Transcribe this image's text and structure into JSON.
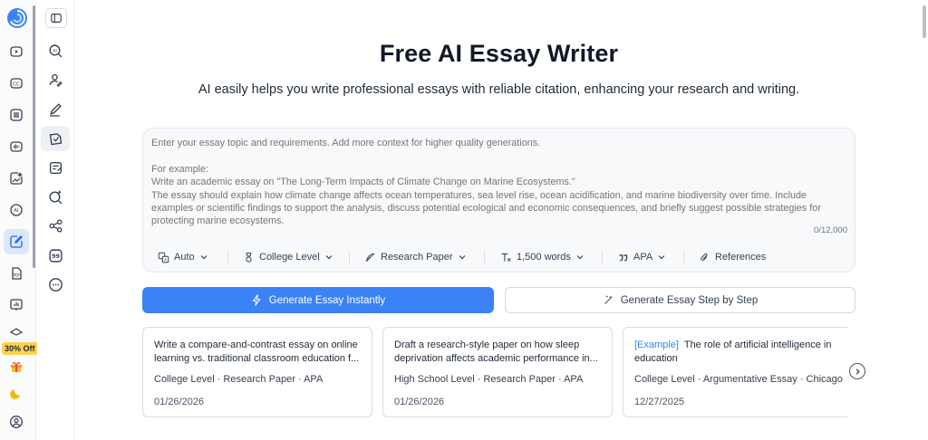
{
  "promo": {
    "badge": "30% Off"
  },
  "main": {
    "title": "Free AI Essay Writer",
    "subtitle": "AI easily helps you write professional essays with reliable citation, enhancing your research and writing."
  },
  "composer": {
    "placeholder": "Enter your essay topic and requirements. Add more context for higher quality generations.\n\nFor example:\nWrite an academic essay on \"The Long-Term Impacts of Climate Change on Marine Ecosystems.\"\nThe essay should explain how climate change affects ocean temperatures, sea level rise, ocean acidification, and marine biodiversity over time. Include examples or scientific findings to support the analysis, discuss potential ecological and economic consequences, and briefly suggest possible strategies for protecting marine ecosystems.",
    "value": "",
    "counter": "0/12,000"
  },
  "options": {
    "language": "Auto",
    "level": "College Level",
    "type": "Research Paper",
    "length": "1,500 words",
    "citation": "APA",
    "references": "References"
  },
  "actions": {
    "generate_instant": "Generate Essay Instantly",
    "generate_step": "Generate Essay Step by Step"
  },
  "history": [
    {
      "tag": "",
      "title": "Write a compare-and-contrast essay on online learning vs. traditional classroom education f...",
      "meta": "College Level · Research Paper · APA",
      "date": "01/26/2026"
    },
    {
      "tag": "",
      "title": "Draft a research-style paper on how sleep deprivation affects academic performance in...",
      "meta": "High School Level · Research Paper · APA",
      "date": "01/26/2026"
    },
    {
      "tag": "[Example]",
      "title": "The role of artificial intelligence in education",
      "meta": "College Level · Argumentative Essay · Chicago",
      "date": "12/27/2025"
    }
  ],
  "icons": {
    "rail": [
      "app-logo",
      "video-icon",
      "captions-icon",
      "list-icon",
      "audio-icon",
      "image-edit-icon",
      "ai-chat-icon",
      "essay-writer-icon",
      "pdf-icon",
      "presentation-icon",
      "hat-icon",
      "gift-icon",
      "moon-icon",
      "account-icon"
    ],
    "tools": [
      "sidebar-toggle-icon",
      "ai-search-icon",
      "humanizer-icon",
      "paraphrase-icon",
      "essay-icon",
      "outline-icon",
      "ai-detector-icon",
      "mindmap-icon",
      "citation-icon",
      "more-icon"
    ]
  },
  "colors": {
    "accent": "#3b82f6",
    "active_rail": "#dbe7fb",
    "promo": "#fcd34d"
  }
}
